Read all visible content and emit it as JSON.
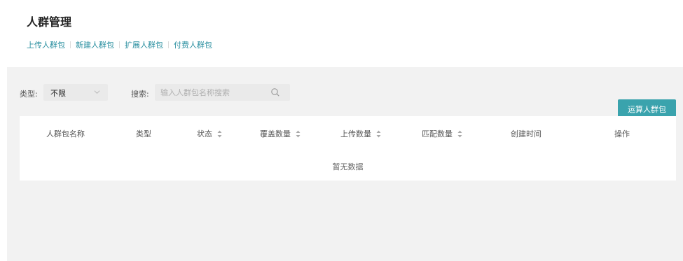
{
  "header": {
    "title": "人群管理",
    "links": [
      "上传人群包",
      "新建人群包",
      "扩展人群包",
      "付费人群包"
    ]
  },
  "filters": {
    "type_label": "类型:",
    "type_value": "不限",
    "search_label": "搜索:",
    "search_placeholder": "输入人群包名称搜索",
    "search_value": ""
  },
  "toolbar": {
    "calc_label": "运算人群包"
  },
  "table": {
    "columns": [
      {
        "label": "人群包名称",
        "sortable": false
      },
      {
        "label": "类型",
        "sortable": false
      },
      {
        "label": "状态",
        "sortable": true
      },
      {
        "label": "覆盖数量",
        "sortable": true
      },
      {
        "label": "上传数量",
        "sortable": true
      },
      {
        "label": "匹配数量",
        "sortable": true
      },
      {
        "label": "创建时间",
        "sortable": false
      },
      {
        "label": "操作",
        "sortable": false
      }
    ],
    "rows": [],
    "empty_text": "暂无数据"
  },
  "colors": {
    "accent": "#3aa3ad",
    "link": "#2a8fa0",
    "content_bg": "#f2f2f2"
  }
}
